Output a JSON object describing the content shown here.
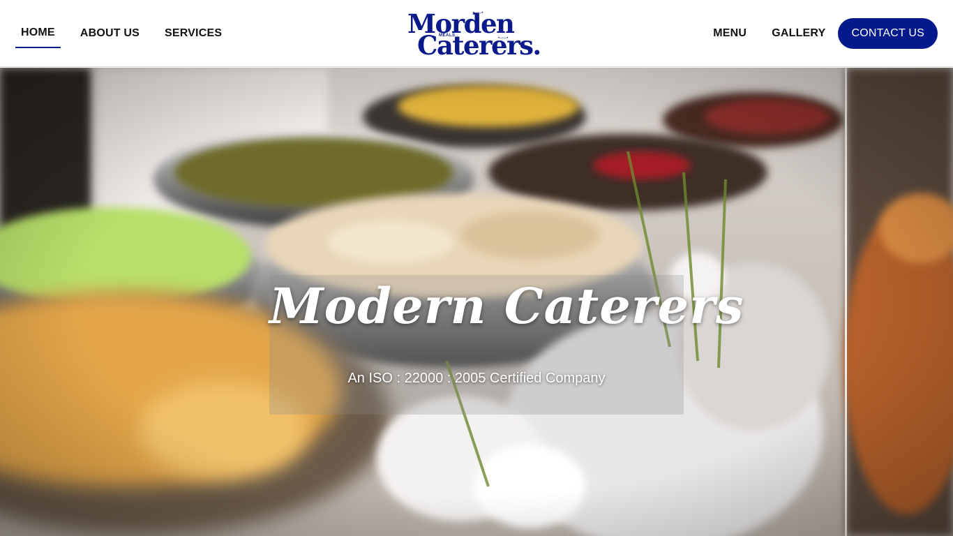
{
  "nav": {
    "left": [
      {
        "label": "HOME",
        "active": true
      },
      {
        "label": "ABOUT US",
        "active": false
      },
      {
        "label": "SERVICES",
        "active": false
      }
    ],
    "right": [
      {
        "label": "MENU"
      },
      {
        "label": "GALLERY"
      }
    ],
    "contact_label": "CONTACT US"
  },
  "logo": {
    "line1": "Morden",
    "line2": "Caterers.",
    "tag": "MEALS"
  },
  "hero": {
    "title": "Modern Caterers",
    "subtitle": "An ISO : 22000 : 2005 Certified Company"
  },
  "colors": {
    "brand": "#041a8c",
    "text": "#111111",
    "white": "#ffffff"
  }
}
